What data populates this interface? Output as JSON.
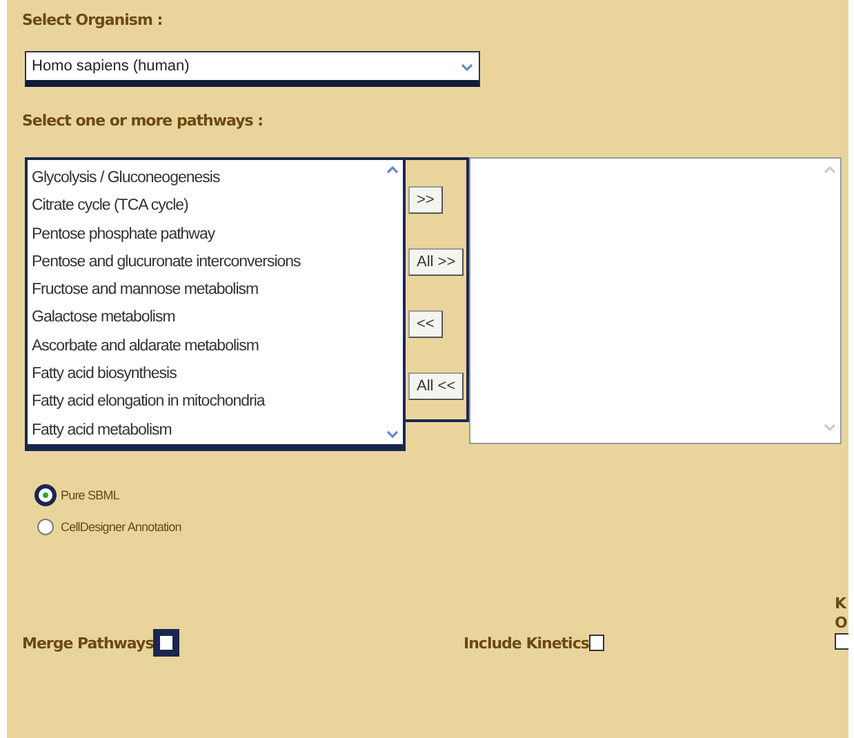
{
  "organism": {
    "label": "Select Organism :",
    "value": "Homo sapiens (human)"
  },
  "pathways": {
    "label": "Select one or more pathways :",
    "available": [
      "Glycolysis / Gluconeogenesis",
      "Citrate cycle (TCA cycle)",
      "Pentose phosphate pathway",
      "Pentose and glucuronate interconversions",
      "Fructose and mannose metabolism",
      "Galactose metabolism",
      "Ascorbate and aldarate metabolism",
      "Fatty acid biosynthesis",
      "Fatty acid elongation in mitochondria",
      "Fatty acid metabolism"
    ],
    "buttons": [
      ">>",
      "All >>",
      "<<",
      "All <<"
    ]
  },
  "format": [
    {
      "label": "Pure SBML",
      "selected": true
    },
    {
      "label": "CellDesigner Annotation",
      "selected": false
    }
  ],
  "options": [
    {
      "label": "Merge Pathways",
      "checked": false
    },
    {
      "label": "Include Kinetics",
      "checked": false
    },
    {
      "label_lines": [
        "K",
        "O"
      ],
      "checked": false
    }
  ]
}
